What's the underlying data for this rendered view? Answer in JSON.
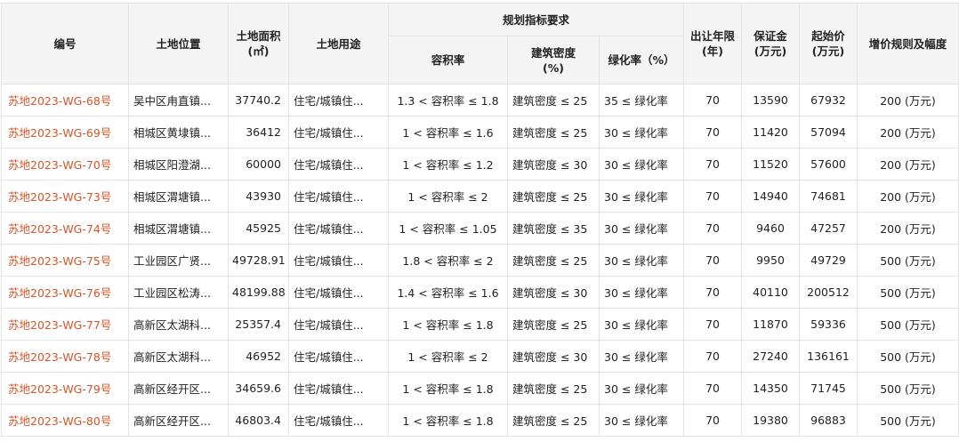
{
  "headers": {
    "code": "编号",
    "location": "土地位置",
    "area_line1": "土地面积",
    "area_line2": "(㎡)",
    "use": "土地用途",
    "planning_group": "规划指标要求",
    "plot_ratio": "容积率",
    "density_line1": "建筑密度",
    "density_line2": "(%)",
    "green": "绿化率（%）",
    "term_line1": "出让年限",
    "term_line2": "(年)",
    "deposit_line1": "保证金",
    "deposit_line2": "(万元)",
    "start_line1": "起始价",
    "start_line2": "(万元)",
    "increment": "增价规则及幅度"
  },
  "rows": [
    {
      "code": "苏地2023-WG-68号",
      "location": "吴中区甪直镇...",
      "area": "37740.2",
      "use": "住宅/城镇住...",
      "plot_ratio": "1.3 < 容积率 ≤ 1.8",
      "density": "建筑密度 ≤ 25",
      "green": "35 ≤ 绿化率",
      "term": "70",
      "deposit": "13590",
      "start": "67932",
      "increment": "200 (万元)"
    },
    {
      "code": "苏地2023-WG-69号",
      "location": "相城区黄埭镇...",
      "area": "36412",
      "use": "住宅/城镇住...",
      "plot_ratio": "1 < 容积率 ≤ 1.6",
      "density": "建筑密度 ≤ 25",
      "green": "30 ≤ 绿化率",
      "term": "70",
      "deposit": "11420",
      "start": "57094",
      "increment": "200 (万元)"
    },
    {
      "code": "苏地2023-WG-70号",
      "location": "相城区阳澄湖...",
      "area": "60000",
      "use": "住宅/城镇住...",
      "plot_ratio": "1 < 容积率 ≤ 1.2",
      "density": "建筑密度 ≤ 30",
      "green": "30 ≤ 绿化率",
      "term": "70",
      "deposit": "11520",
      "start": "57600",
      "increment": "200 (万元)"
    },
    {
      "code": "苏地2023-WG-73号",
      "location": "相城区渭塘镇...",
      "area": "43930",
      "use": "住宅/城镇住...",
      "plot_ratio": "1 < 容积率 ≤ 2",
      "density": "建筑密度 ≤ 25",
      "green": "30 ≤ 绿化率",
      "term": "70",
      "deposit": "14940",
      "start": "74681",
      "increment": "200 (万元)"
    },
    {
      "code": "苏地2023-WG-74号",
      "location": "相城区渭塘镇...",
      "area": "45925",
      "use": "住宅/城镇住...",
      "plot_ratio": "1 < 容积率 ≤ 1.05",
      "density": "建筑密度 ≤ 35",
      "green": "30 ≤ 绿化率",
      "term": "70",
      "deposit": "9460",
      "start": "47257",
      "increment": "200 (万元)"
    },
    {
      "code": "苏地2023-WG-75号",
      "location": "工业园区广贤...",
      "area": "49728.91",
      "use": "住宅/城镇住...",
      "plot_ratio": "1.8 < 容积率 ≤ 2",
      "density": "建筑密度 ≤ 25",
      "green": "30 ≤ 绿化率",
      "term": "70",
      "deposit": "9950",
      "start": "49729",
      "increment": "500 (万元)"
    },
    {
      "code": "苏地2023-WG-76号",
      "location": "工业园区松涛...",
      "area": "48199.88",
      "use": "住宅/城镇住...",
      "plot_ratio": "1.4 < 容积率 ≤ 1.6",
      "density": "建筑密度 ≤ 30",
      "green": "30 ≤ 绿化率",
      "term": "70",
      "deposit": "40110",
      "start": "200512",
      "increment": "500 (万元)"
    },
    {
      "code": "苏地2023-WG-77号",
      "location": "高新区太湖科...",
      "area": "25357.4",
      "use": "住宅/城镇住...",
      "plot_ratio": "1 < 容积率 ≤ 1.8",
      "density": "建筑密度 ≤ 25",
      "green": "30 ≤ 绿化率",
      "term": "70",
      "deposit": "11870",
      "start": "59336",
      "increment": "500 (万元)"
    },
    {
      "code": "苏地2023-WG-78号",
      "location": "高新区太湖科...",
      "area": "46952",
      "use": "住宅/城镇住...",
      "plot_ratio": "1 < 容积率 ≤ 2",
      "density": "建筑密度 ≤ 30",
      "green": "30 ≤ 绿化率",
      "term": "70",
      "deposit": "27240",
      "start": "136161",
      "increment": "500 (万元)"
    },
    {
      "code": "苏地2023-WG-79号",
      "location": "高新区经开区...",
      "area": "34659.6",
      "use": "住宅/城镇住...",
      "plot_ratio": "1 < 容积率 ≤ 1.8",
      "density": "建筑密度 ≤ 25",
      "green": "30 ≤ 绿化率",
      "term": "70",
      "deposit": "14350",
      "start": "71745",
      "increment": "500 (万元)"
    },
    {
      "code": "苏地2023-WG-80号",
      "location": "高新区经开区...",
      "area": "46803.4",
      "use": "住宅/城镇住...",
      "plot_ratio": "1 < 容积率 ≤ 1.8",
      "density": "建筑密度 ≤ 25",
      "green": "30 ≤ 绿化率",
      "term": "70",
      "deposit": "19380",
      "start": "96883",
      "increment": "500 (万元)"
    }
  ],
  "colors": {
    "code_link": "#d9542a",
    "header_bg": "#f4f4f4",
    "border": "#e3e3e3"
  }
}
